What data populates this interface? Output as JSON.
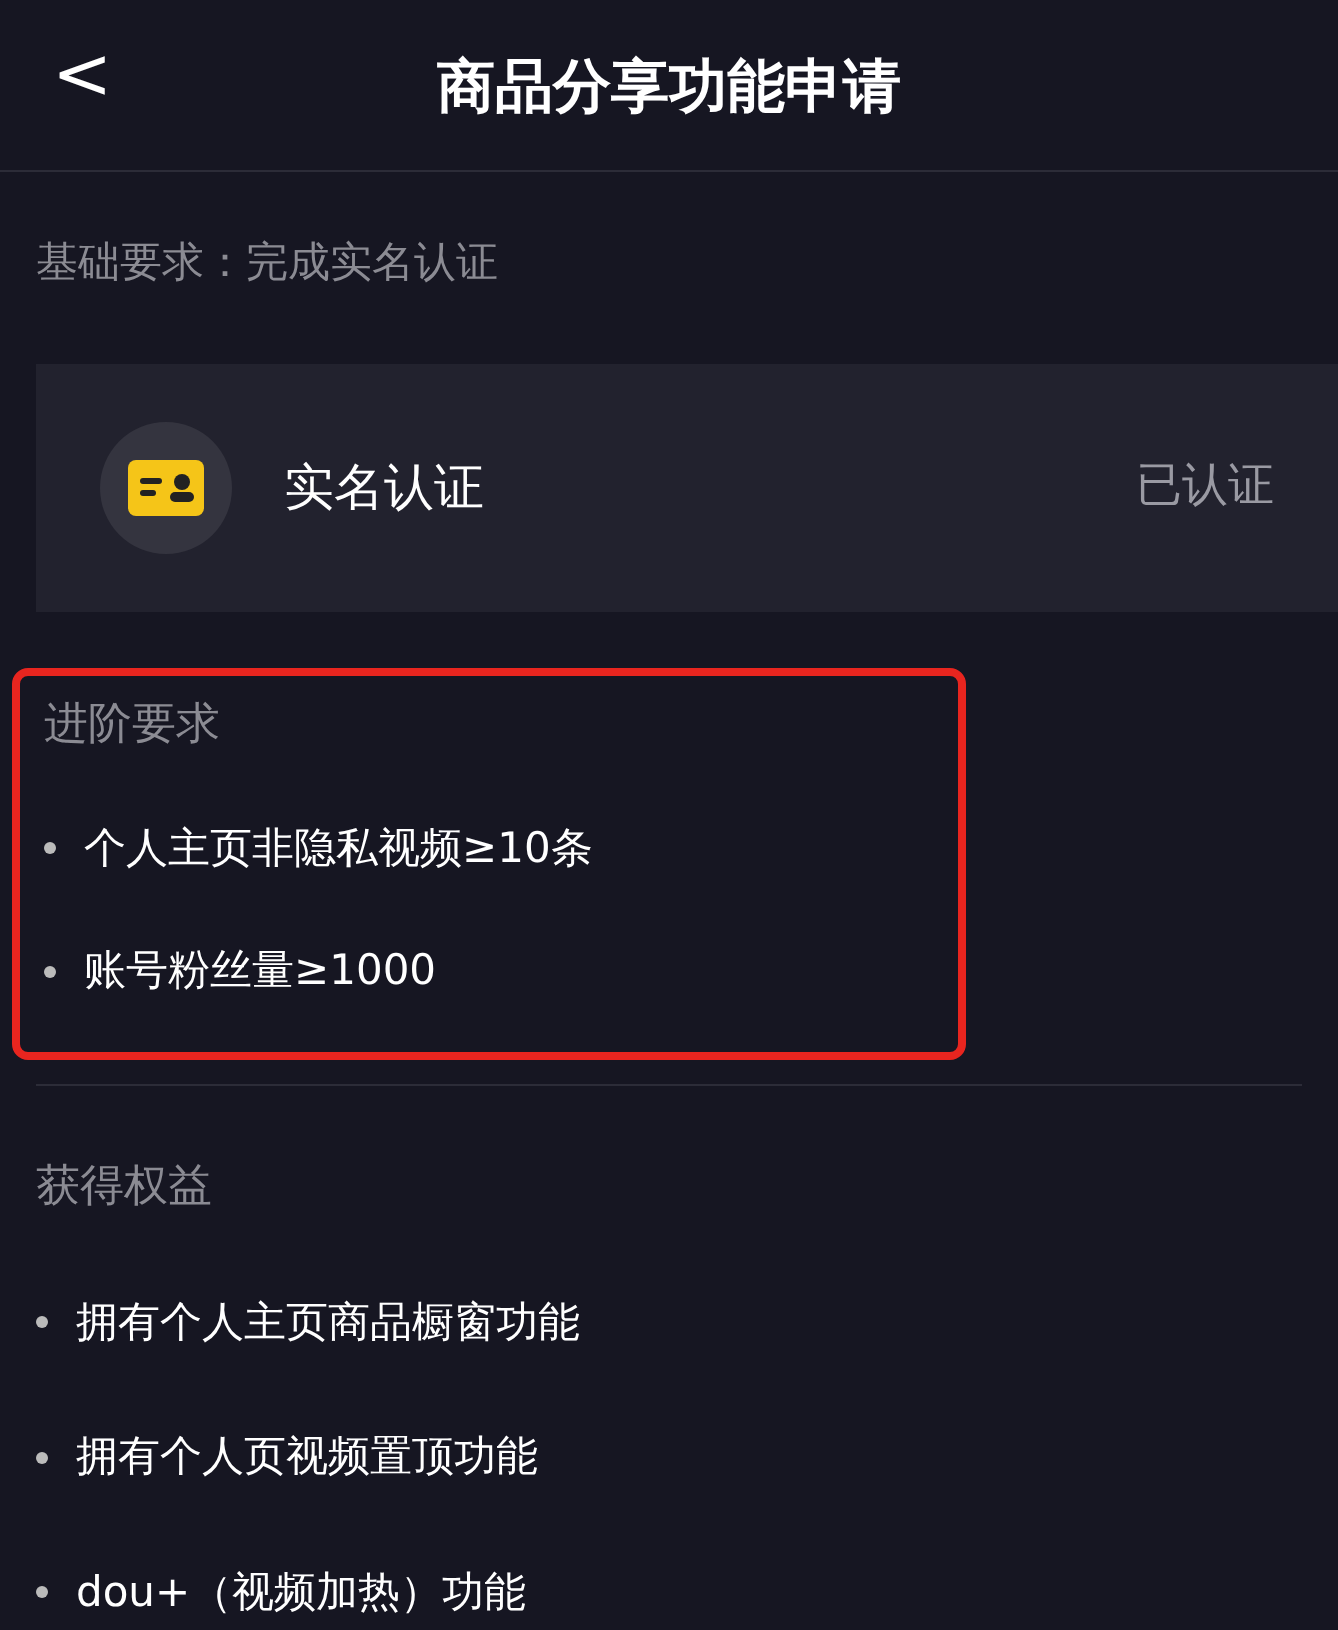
{
  "header": {
    "back": "<",
    "title": "商品分享功能申请"
  },
  "basic": {
    "label": "基础要求：完成实名认证",
    "card": {
      "name": "实名认证",
      "status": "已认证"
    }
  },
  "advanced": {
    "title": "进阶要求",
    "highlighted": true,
    "items": [
      "个人主页非隐私视频≥10条",
      "账号粉丝量≥1000"
    ]
  },
  "benefits": {
    "title": "获得权益",
    "items": [
      "拥有个人主页商品橱窗功能",
      "拥有个人页视频置顶功能",
      "dou+（视频加热）功能"
    ]
  }
}
